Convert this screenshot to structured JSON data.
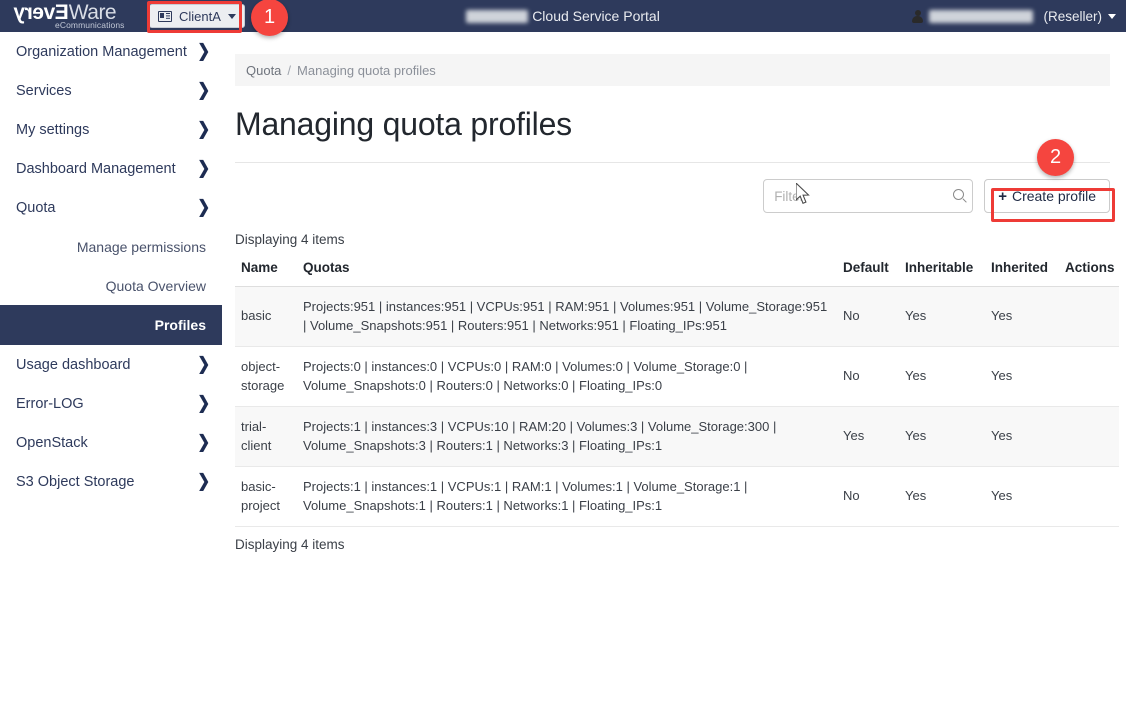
{
  "header": {
    "logo_main_reversed": "Every",
    "logo_main_normal": "Ware",
    "logo_sub": "eCommunications",
    "client_selector_label": "ClientA",
    "portal_title": "Cloud Service Portal",
    "user_role": "(Reseller)"
  },
  "sidebar": {
    "items": [
      {
        "label": "Organization Management",
        "chevron": "chevron-right-icon",
        "type": "top"
      },
      {
        "label": "Services",
        "chevron": "chevron-right-icon",
        "type": "top"
      },
      {
        "label": "My settings",
        "chevron": "chevron-right-icon",
        "type": "top"
      },
      {
        "label": "Dashboard Management",
        "chevron": "chevron-right-icon",
        "type": "top"
      },
      {
        "label": "Quota",
        "chevron": "chevron-down-icon",
        "type": "top"
      }
    ],
    "sub_items": [
      {
        "label": "Manage permissions",
        "active": false
      },
      {
        "label": "Quota Overview",
        "active": false
      },
      {
        "label": "Profiles",
        "active": true
      }
    ],
    "items_after": [
      {
        "label": "Usage dashboard",
        "chevron": "chevron-right-icon"
      },
      {
        "label": "Error-LOG",
        "chevron": "chevron-right-icon"
      },
      {
        "label": "OpenStack",
        "chevron": "chevron-right-icon"
      },
      {
        "label": "S3 Object Storage",
        "chevron": "chevron-right-icon"
      }
    ]
  },
  "breadcrumb": {
    "parent": "Quota",
    "separator": "/",
    "current": "Managing quota profiles"
  },
  "page": {
    "title": "Managing quota profiles",
    "count_top": "Displaying 4 items",
    "count_bottom": "Displaying 4 items"
  },
  "toolbar": {
    "filter_placeholder": "Filter",
    "filter_value": "",
    "create_button_label": "Create profile",
    "create_button_plus": "+"
  },
  "table": {
    "columns": [
      "Name",
      "Quotas",
      "Default",
      "Inheritable",
      "Inherited",
      "Actions"
    ],
    "rows": [
      {
        "name": "basic",
        "quotas": "Projects:951 | instances:951 | VCPUs:951 | RAM:951 | Volumes:951 | Volume_Storage:951 | Volume_Snapshots:951 | Routers:951 | Networks:951 | Floating_IPs:951",
        "default": "No",
        "inheritable": "Yes",
        "inherited": "Yes",
        "actions": ""
      },
      {
        "name": "object-storage",
        "quotas": "Projects:0 | instances:0 | VCPUs:0 | RAM:0 | Volumes:0 | Volume_Storage:0 | Volume_Snapshots:0 | Routers:0 | Networks:0 | Floating_IPs:0",
        "default": "No",
        "inheritable": "Yes",
        "inherited": "Yes",
        "actions": ""
      },
      {
        "name": "trial-client",
        "quotas": "Projects:1 | instances:3 | VCPUs:10 | RAM:20 | Volumes:3 | Volume_Storage:300 | Volume_Snapshots:3 | Routers:1 | Networks:3 | Floating_IPs:1",
        "default": "Yes",
        "inheritable": "Yes",
        "inherited": "Yes",
        "actions": ""
      },
      {
        "name": "basic-project",
        "quotas": "Projects:1 | instances:1 | VCPUs:1 | RAM:1 | Volumes:1 | Volume_Storage:1 | Volume_Snapshots:1 | Routers:1 | Networks:1 | Floating_IPs:1",
        "default": "No",
        "inheritable": "Yes",
        "inherited": "Yes",
        "actions": ""
      }
    ]
  },
  "annotations": {
    "badge_one": "1",
    "badge_two": "2"
  },
  "colors": {
    "brand_navy": "#2e3a5c",
    "annotation_red": "#f5453f",
    "row_stripe": "#f8f8f8"
  }
}
